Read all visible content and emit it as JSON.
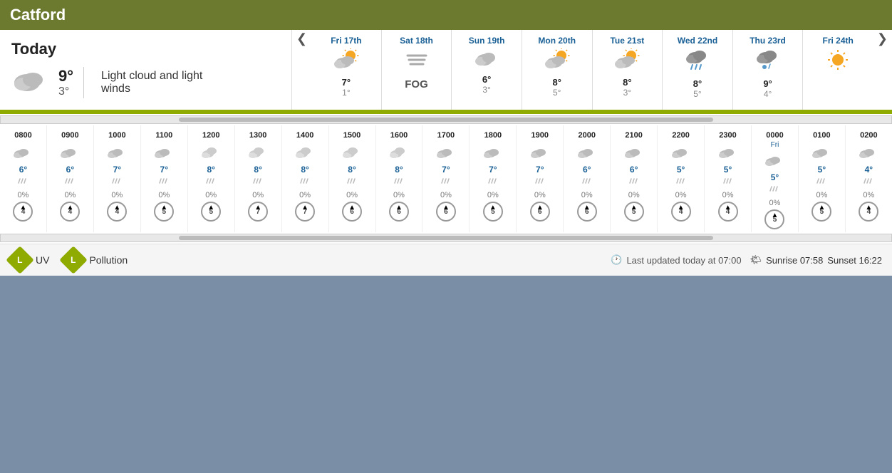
{
  "header": {
    "location": "Catford"
  },
  "today": {
    "label": "Today",
    "high": "9°",
    "low": "3°",
    "description": "Light cloud and light winds",
    "icon": "cloud"
  },
  "days": [
    {
      "name": "Fri 17th",
      "icon": "partly-sunny",
      "high": "7°",
      "low": "1°"
    },
    {
      "name": "Sat 18th",
      "icon": "fog",
      "high": "",
      "low": "",
      "label": "FOG"
    },
    {
      "name": "Sun 19th",
      "icon": "cloud",
      "high": "6°",
      "low": "3°"
    },
    {
      "name": "Mon 20th",
      "icon": "partly-sunny",
      "high": "8°",
      "low": "5°"
    },
    {
      "name": "Tue 21st",
      "icon": "partly-sunny",
      "high": "8°",
      "low": "3°"
    },
    {
      "name": "Wed 22nd",
      "icon": "rain-cloud",
      "high": "8°",
      "low": "5°"
    },
    {
      "name": "Thu 23rd",
      "icon": "rain-drop",
      "high": "9°",
      "low": "4°"
    },
    {
      "name": "Fri 24th",
      "icon": "sun",
      "high": "",
      "low": ""
    }
  ],
  "hours": [
    {
      "time": "0800",
      "sublabel": "",
      "icon": "cloud",
      "temp": "6°",
      "rain": "0%",
      "wind": 4
    },
    {
      "time": "0900",
      "sublabel": "",
      "icon": "cloud",
      "temp": "6°",
      "rain": "0%",
      "wind": 4
    },
    {
      "time": "1000",
      "sublabel": "",
      "icon": "cloud",
      "temp": "7°",
      "rain": "0%",
      "wind": 4
    },
    {
      "time": "1100",
      "sublabel": "",
      "icon": "cloud",
      "temp": "7°",
      "rain": "0%",
      "wind": 5
    },
    {
      "time": "1200",
      "sublabel": "",
      "icon": "cloud-high",
      "temp": "8°",
      "rain": "0%",
      "wind": 5
    },
    {
      "time": "1300",
      "sublabel": "",
      "icon": "cloud-high",
      "temp": "8°",
      "rain": "0%",
      "wind": 7
    },
    {
      "time": "1400",
      "sublabel": "",
      "icon": "cloud-high",
      "temp": "8°",
      "rain": "0%",
      "wind": 7
    },
    {
      "time": "1500",
      "sublabel": "",
      "icon": "cloud-high",
      "temp": "8°",
      "rain": "0%",
      "wind": 6
    },
    {
      "time": "1600",
      "sublabel": "",
      "icon": "cloud-high",
      "temp": "8°",
      "rain": "0%",
      "wind": 6
    },
    {
      "time": "1700",
      "sublabel": "",
      "icon": "cloud",
      "temp": "7°",
      "rain": "0%",
      "wind": 6
    },
    {
      "time": "1800",
      "sublabel": "",
      "icon": "cloud",
      "temp": "7°",
      "rain": "0%",
      "wind": 5
    },
    {
      "time": "1900",
      "sublabel": "",
      "icon": "cloud",
      "temp": "7°",
      "rain": "0%",
      "wind": 6
    },
    {
      "time": "2000",
      "sublabel": "",
      "icon": "cloud",
      "temp": "6°",
      "rain": "0%",
      "wind": 6
    },
    {
      "time": "2100",
      "sublabel": "",
      "icon": "cloud",
      "temp": "6°",
      "rain": "0%",
      "wind": 5
    },
    {
      "time": "2200",
      "sublabel": "",
      "icon": "cloud",
      "temp": "5°",
      "rain": "0%",
      "wind": 4
    },
    {
      "time": "2300",
      "sublabel": "",
      "icon": "cloud",
      "temp": "5°",
      "rain": "0%",
      "wind": 4
    },
    {
      "time": "0000",
      "sublabel": "Fri",
      "icon": "cloud",
      "temp": "5°",
      "rain": "0%",
      "wind": 5
    },
    {
      "time": "0100",
      "sublabel": "",
      "icon": "cloud",
      "temp": "5°",
      "rain": "0%",
      "wind": 5
    },
    {
      "time": "0200",
      "sublabel": "",
      "icon": "cloud",
      "temp": "4°",
      "rain": "0%",
      "wind": 4
    }
  ],
  "footer": {
    "uv_label": "UV",
    "uv_level": "L",
    "pollution_label": "Pollution",
    "pollution_level": "L",
    "last_updated": "Last updated today at 07:00",
    "sunrise": "Sunrise 07:58",
    "sunset": "Sunset 16:22"
  }
}
